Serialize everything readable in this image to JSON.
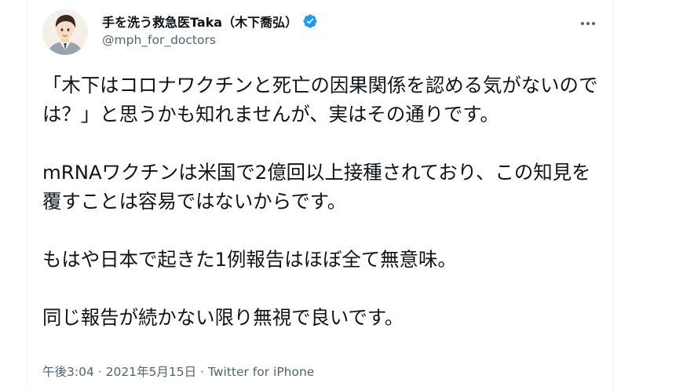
{
  "tweet": {
    "author": {
      "display_name": "手を洗う救急医Taka（木下喬弘）",
      "handle": "@mph_for_doctors",
      "verified": true
    },
    "more_icon": "more-horizontal-icon",
    "verified_icon": "verified-badge-icon",
    "paragraphs": [
      "「木下はコロナワクチンと死亡の因果関係を認める気がないのでは？」と思うかも知れませんが、実はその通りです。",
      "mRNAワクチンは米国で2億回以上接種されており、この知見を覆すことは容易ではないからです。",
      "もはや日本で起きた1例報告はほぼ全て無意味。",
      "同じ報告が続かない限り無視で良いです。"
    ],
    "meta": {
      "time": "午後3:04",
      "separator": " · ",
      "date": "2021年5月15日",
      "source": "Twitter for iPhone"
    },
    "colors": {
      "text": "#0f1419",
      "secondary": "#536471",
      "verified": "#1d9bf0"
    }
  }
}
